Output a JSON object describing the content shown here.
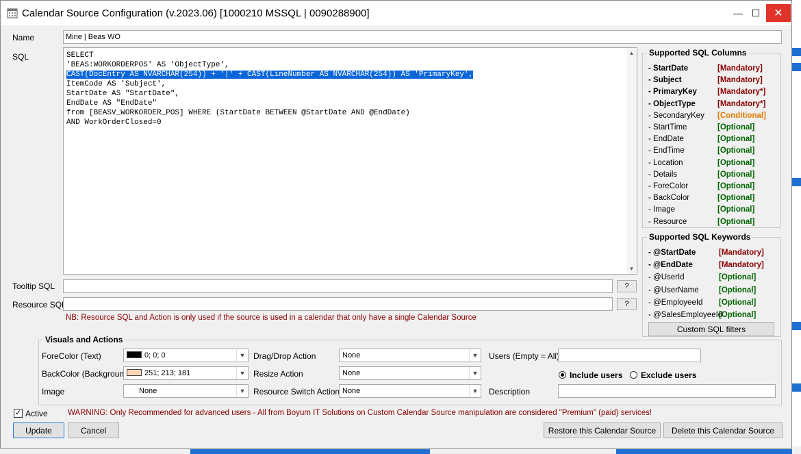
{
  "window": {
    "title": "Calendar Source Configuration (v.2023.06) [1000210 MSSQL | 0090288900]",
    "min_glyph": "—",
    "max_glyph": "☐",
    "close_glyph": "✕",
    "title_icon": "calendar-icon"
  },
  "form": {
    "name_label": "Name",
    "name_value": "Mine | Beas WO",
    "sql_label": "SQL",
    "sql_lines": [
      "SELECT",
      "'BEAS:WORKORDERPOS' AS 'ObjectType',",
      "CAST(DocEntry AS NVARCHAR(254)) + '|' + CAST(LineNumber AS NVARCHAR(254)) AS 'PrimaryKey',",
      "ItemCode AS 'Subject',",
      "StartDate AS \"StartDate\",",
      "EndDate AS \"EndDate\"",
      "from [BEASV_WORKORDER_POS] WHERE (StartDate BETWEEN @StartDate AND @EndDate)",
      "AND WorkOrderClosed=0"
    ],
    "tooltip_sql_label": "Tooltip SQL",
    "tooltip_sql_value": "",
    "resource_sql_label": "Resource SQL",
    "resource_sql_value": "",
    "help_button": "?",
    "note": "NB: Resource SQL and Action is only used if the source is used in a calendar that only have a single Calendar Source"
  },
  "columns": {
    "title": "Supported SQL Columns",
    "items": [
      {
        "name": "- StartDate",
        "req": "[Mandatory]"
      },
      {
        "name": "- Subject",
        "req": "[Mandatory]"
      },
      {
        "name": "- PrimaryKey",
        "req": "[Mandatory*]"
      },
      {
        "name": "- ObjectType",
        "req": "[Mandatory*]"
      },
      {
        "name": "- SecondaryKey",
        "req": "[Conditional]"
      },
      {
        "name": "- StartTime",
        "req": "[Optional]"
      },
      {
        "name": "- EndDate",
        "req": "[Optional]"
      },
      {
        "name": "- EndTime",
        "req": "[Optional]"
      },
      {
        "name": "- Location",
        "req": "[Optional]"
      },
      {
        "name": "- Details",
        "req": "[Optional]"
      },
      {
        "name": "- ForeColor",
        "req": "[Optional]"
      },
      {
        "name": "- BackColor",
        "req": "[Optional]"
      },
      {
        "name": "- Image",
        "req": "[Optional]"
      },
      {
        "name": "- Resource",
        "req": "[Optional]"
      }
    ]
  },
  "keywords": {
    "title": "Supported SQL Keywords",
    "items": [
      {
        "name": "- @StartDate",
        "req": "[Mandatory]"
      },
      {
        "name": "- @EndDate",
        "req": "[Mandatory]"
      },
      {
        "name": "- @UserId",
        "req": "[Optional]"
      },
      {
        "name": "- @UserName",
        "req": "[Optional]"
      },
      {
        "name": "- @EmployeeId",
        "req": "[Optional]"
      },
      {
        "name": "- @SalesEmployeeId",
        "req": "[Optional]"
      }
    ],
    "custom_filters_button": "Custom SQL filters"
  },
  "visuals": {
    "title": "Visuals and Actions",
    "forecolor_label": "ForeColor (Text)",
    "forecolor_value": "0; 0; 0",
    "forecolor_swatch": "#000000",
    "backcolor_label": "BackColor (Background)",
    "backcolor_value": "251; 213; 181",
    "backcolor_swatch": "#fbd5b5",
    "image_label": "Image",
    "image_value": "None",
    "dragdrop_label": "Drag/Drop Action",
    "dragdrop_value": "None",
    "resize_label": "Resize Action",
    "resize_value": "None",
    "resource_switch_label": "Resource Switch Action",
    "resource_switch_value": "None",
    "users_label": "Users (Empty = All)",
    "users_value": "",
    "include_users": "Include users",
    "exclude_users": "Exclude users",
    "description_label": "Description",
    "description_value": ""
  },
  "footer": {
    "active_label": "Active",
    "active_check": "✓",
    "warning": "WARNING: Only Recommended for advanced users - All from Boyum IT Solutions on Custom Calendar Source manipulation are considered \"Premium\" (paid) services!",
    "update": "Update",
    "cancel": "Cancel",
    "restore": "Restore this Calendar Source",
    "delete": "Delete this Calendar Source"
  },
  "colors": {
    "mandatory": "#8b0000",
    "conditional": "#e07a00",
    "optional": "#006400",
    "selection": "#0a66d8",
    "close_red": "#e0342a"
  }
}
